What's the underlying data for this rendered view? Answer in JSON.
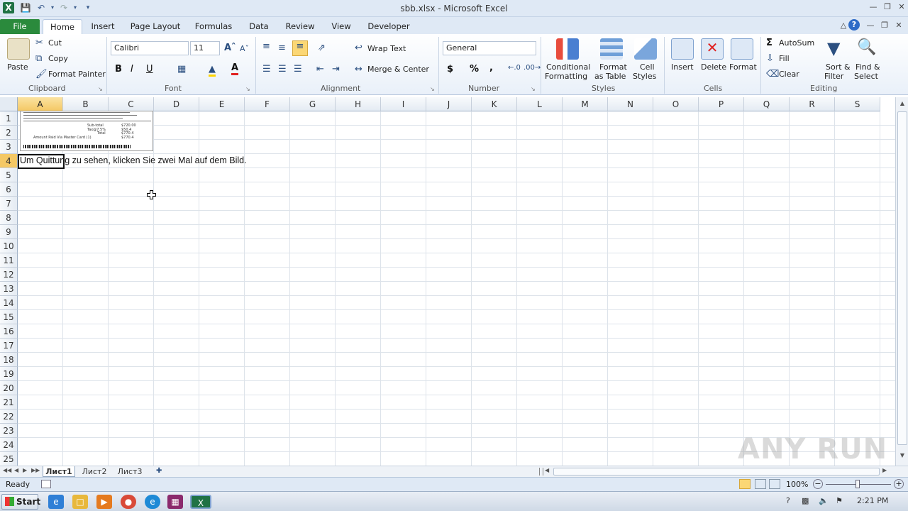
{
  "window": {
    "title": "sbb.xlsx - Microsoft Excel"
  },
  "tabs": [
    "File",
    "Home",
    "Insert",
    "Page Layout",
    "Formulas",
    "Data",
    "Review",
    "View",
    "Developer"
  ],
  "clipboard": {
    "paste": "Paste",
    "cut": "Cut",
    "copy": "Copy",
    "format_painter": "Format Painter",
    "label": "Clipboard"
  },
  "font": {
    "name": "Calibri",
    "size": "11",
    "bold": "B",
    "italic": "I",
    "underline": "U",
    "label": "Font"
  },
  "alignment": {
    "wrap_text": "Wrap Text",
    "merge_center": "Merge & Center",
    "label": "Alignment"
  },
  "number": {
    "format": "General",
    "currency": "$",
    "percent": "%",
    "comma": ",",
    "label": "Number"
  },
  "styles": {
    "conditional": "Conditional",
    "formatting": "Formatting",
    "format_as": "Format",
    "as_table": "as Table",
    "cell": "Cell",
    "cell_styles": "Styles",
    "label": "Styles"
  },
  "cells": {
    "insert": "Insert",
    "delete": "Delete",
    "format": "Format",
    "label": "Cells"
  },
  "editing": {
    "autosum": "AutoSum",
    "fill": "Fill",
    "clear": "Clear",
    "sort": "Sort &",
    "filter": "Filter",
    "find": "Find &",
    "select": "Select",
    "label": "Editing"
  },
  "columns": [
    "A",
    "B",
    "C",
    "D",
    "E",
    "F",
    "G",
    "H",
    "I",
    "J",
    "K",
    "L",
    "M",
    "N",
    "O",
    "P",
    "Q",
    "R",
    "S"
  ],
  "rows": [
    "1",
    "2",
    "3",
    "4",
    "5",
    "6",
    "7",
    "8",
    "9",
    "10",
    "11",
    "12",
    "13",
    "14",
    "15",
    "16",
    "17",
    "18",
    "19",
    "20",
    "21",
    "22",
    "23",
    "24",
    "25"
  ],
  "cell_a4": "Um Quittung zu sehen, klicken Sie zwei Mal auf dem Bild.",
  "sheets": [
    "Лист1",
    "Лист2",
    "Лист3"
  ],
  "status": {
    "ready": "Ready",
    "zoom": "100%"
  },
  "taskbar": {
    "start": "Start",
    "time": "2:21 PM"
  },
  "watermark": "ANY RUN",
  "receipt": {
    "subtotal_label": "Sub-total",
    "subtotal": "$720.00",
    "tax_label": "Tax@7.5%",
    "tax": "$50.4",
    "total_label": "Total",
    "total": "$770.4",
    "paid_label": "Amount Paid Via Master Card (1)",
    "paid": "$770.4"
  }
}
